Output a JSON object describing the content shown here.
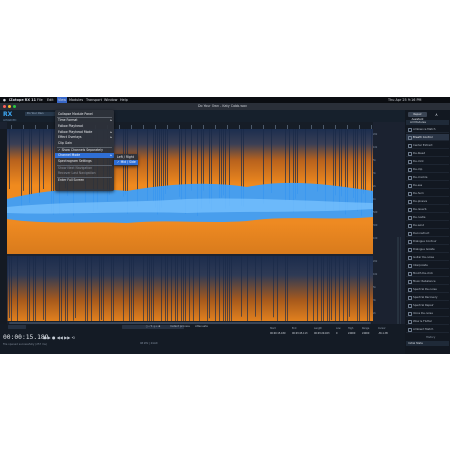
{
  "menubar": {
    "app_name": "iZotope RX 11",
    "items": [
      "File",
      "Edit",
      "View",
      "Modules",
      "Transport",
      "Window",
      "Help"
    ],
    "clock": "Thu Apr 25  9:16 PM"
  },
  "window": {
    "title": "Do Your Own - Katy Cobb.wav"
  },
  "logo": {
    "brand": "RX",
    "sub": "ADVANCED"
  },
  "tab": {
    "label": "Do Your Own"
  },
  "view_menu": {
    "items": [
      {
        "label": "Collapse Module Panel",
        "state": "normal"
      },
      {
        "label": "Time Format",
        "state": "normal",
        "submenu": true
      },
      {
        "label": "Follow Playhead",
        "state": "normal"
      },
      {
        "label": "Follow Playhead Mode",
        "state": "normal",
        "submenu": true
      },
      {
        "label": "Effect Overlays",
        "state": "normal",
        "submenu": true
      },
      {
        "label": "Clip Gain",
        "state": "normal"
      },
      {
        "label": "✓ Show Channels Separately",
        "state": "normal"
      },
      {
        "label": "Channel Mode",
        "state": "selected",
        "submenu": true
      },
      {
        "label": "Spectrogram Settings",
        "state": "normal"
      },
      {
        "label": "Show Next Navigation",
        "state": "disabled"
      },
      {
        "label": "Recover Last Navigation",
        "state": "disabled"
      },
      {
        "label": "Enter Full Screen",
        "state": "normal"
      }
    ],
    "channel_submenu": [
      "Left / Right",
      "✓ Mid / Side"
    ]
  },
  "right_panel": {
    "repair_button": "Repair Assistant",
    "header": "All Modules",
    "modules": [
      "Ambience Match",
      "Breath Control",
      "Center Extract",
      "De-bleed",
      "De-click",
      "De-clip",
      "De-crackle",
      "De-ess",
      "De-hum",
      "De-plosive",
      "De-reverb",
      "De-rustle",
      "De-wind",
      "Deconstruct",
      "Dialogue Contour",
      "Dialogue Isolate",
      "Guitar De-noise",
      "Interpolate",
      "Mouth De-click",
      "Music Rebalance",
      "Spectral De-noise",
      "Spectral Recovery",
      "Spectral Repair",
      "Voice De-noise",
      "Wow & Flutter",
      "Ambient Match"
    ],
    "highlight_index": 1
  },
  "frequency_scale": [
    "20k",
    "10k",
    "5k",
    "3k",
    "2k",
    "1k",
    "500",
    "300",
    "100",
    "20k",
    "10k",
    "5k",
    "3k",
    "2k",
    "1k",
    "500",
    "300",
    "100"
  ],
  "bottom": {
    "timecode": "00:00:15.189",
    "status": "File opened successfully (257 ms)",
    "instant_process": "Instant process",
    "attenuate": "Attenuate",
    "format": "48 kHz | 24-bit",
    "stats_labels": [
      "Start",
      "End",
      "Length",
      "Low",
      "High",
      "Range",
      "Cursor"
    ],
    "stats_values": [
      "00:00:15.189",
      "00:03:45.113",
      "00:03:29.923",
      "0",
      "24000",
      "24000",
      "-36.1 dB"
    ]
  },
  "history": {
    "label": "History",
    "item": "Initial State"
  },
  "colors": {
    "spectrogram_hot": "#f08a1e",
    "spectrogram_cool": "#1e3a66",
    "waveform": "#3aa0ff",
    "menu_selected": "#2f6fd6"
  }
}
